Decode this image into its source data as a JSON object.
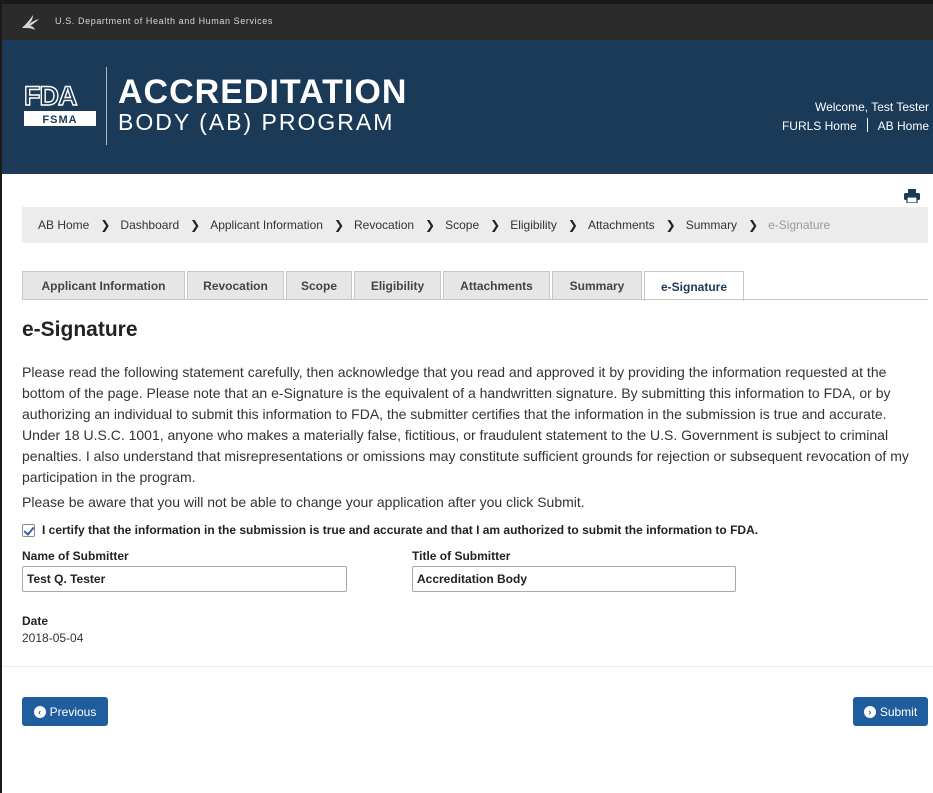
{
  "hhs_bar": {
    "text": "U.S. Department of Health and Human Services",
    "icon": "hhs-eagle-icon"
  },
  "brand": {
    "logo": "fda-fsma-logo",
    "logo_text_fda": "FDA",
    "logo_text_fsma": "FSMA",
    "title": "ACCREDITATION",
    "subtitle": "BODY (AB) PROGRAM"
  },
  "user": {
    "welcome": "Welcome, Test Tester",
    "links": [
      "FURLS Home",
      "AB Home"
    ]
  },
  "print_icon": "print-icon",
  "breadcrumb": [
    "AB Home",
    "Dashboard",
    "Applicant Information",
    "Revocation",
    "Scope",
    "Eligibility",
    "Attachments",
    "Summary",
    "e-Signature"
  ],
  "tabs": [
    {
      "label": "Applicant Information"
    },
    {
      "label": "Revocation"
    },
    {
      "label": "Scope"
    },
    {
      "label": "Eligibility"
    },
    {
      "label": "Attachments"
    },
    {
      "label": "Summary"
    },
    {
      "label": "e-Signature",
      "active": true
    }
  ],
  "page_title": "e-Signature",
  "statement": "Please read the following statement carefully, then acknowledge that you read and approved it by providing the information requested at the bottom of the page. Please note that an e-Signature is the equivalent of a handwritten signature. By submitting this information to FDA, or by authorizing an individual to submit this information to FDA, the submitter certifies that the information in the submission is true and accurate. Under 18 U.S.C. 1001, anyone who makes a materially false, fictitious, or fraudulent statement to the U.S. Government is subject to criminal penalties. I also understand that misrepresentations or omissions may constitute sufficient grounds for rejection or subsequent revocation of my participation in the program.",
  "note": "Please be aware that you will not be able to change your application after you click Submit.",
  "certify": {
    "checked": true,
    "label": "I certify that the information in the submission is true and accurate and that I am authorized to submit the information to FDA."
  },
  "fields": {
    "name_label": "Name of Submitter",
    "name_value": "Test Q. Tester",
    "title_label": "Title of Submitter",
    "title_value": "Accreditation Body"
  },
  "date": {
    "label": "Date",
    "value": "2018-05-04"
  },
  "buttons": {
    "previous": "Previous",
    "submit": "Submit"
  },
  "colors": {
    "header_bg": "#1b3a57",
    "hhs_bg": "#2b2b2b",
    "button": "#1f5d9e"
  }
}
